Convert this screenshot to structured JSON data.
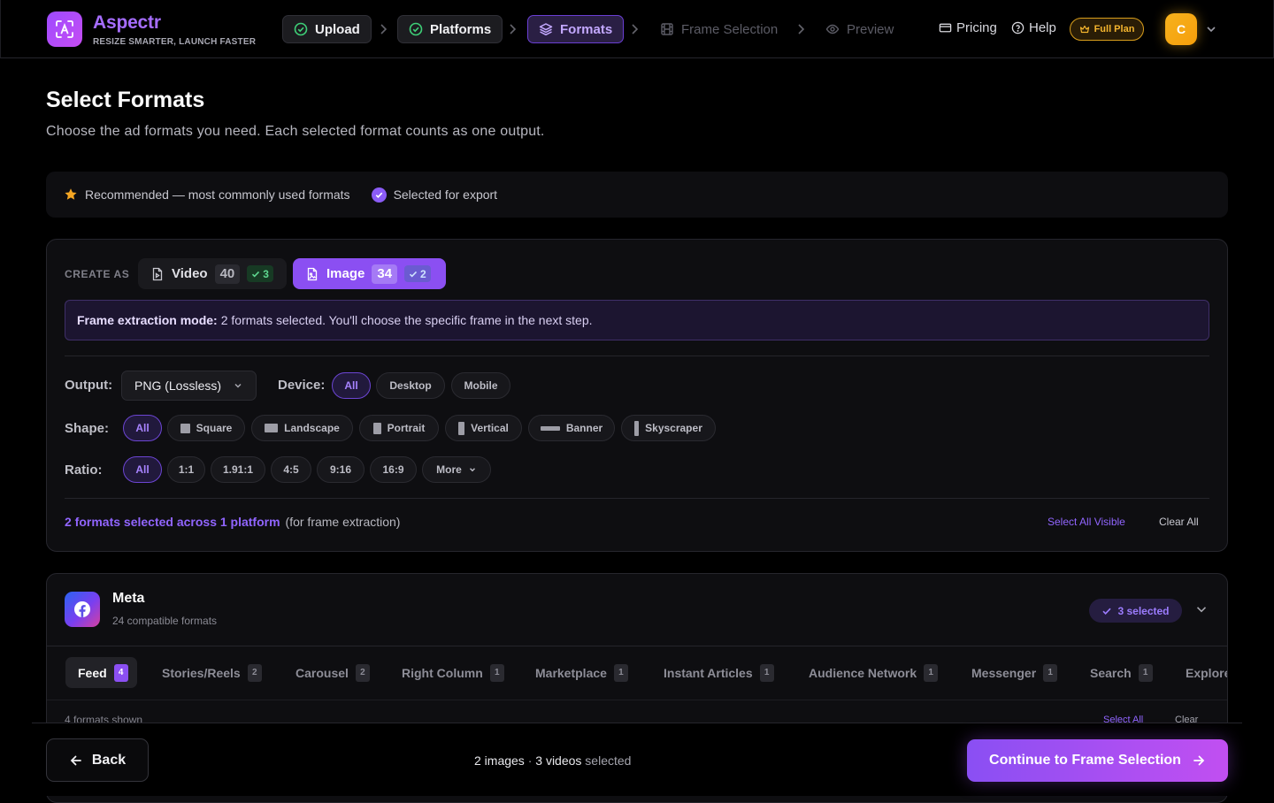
{
  "header": {
    "brand": "Aspectr",
    "tagline": "RESIZE SMARTER, LAUNCH FASTER",
    "steps": [
      {
        "label": "Upload",
        "state": "done"
      },
      {
        "label": "Platforms",
        "state": "done"
      },
      {
        "label": "Formats",
        "state": "active"
      },
      {
        "label": "Frame Selection",
        "state": "todo"
      },
      {
        "label": "Preview",
        "state": "todo"
      }
    ],
    "pricing": "Pricing",
    "help": "Help",
    "plan": "Full Plan",
    "avatar_initial": "C"
  },
  "page": {
    "title": "Select Formats",
    "subtitle": "Choose the ad formats you need. Each selected format counts as one output."
  },
  "legend": {
    "recommended": "Recommended — most commonly used formats",
    "selected": "Selected for export"
  },
  "config": {
    "create_as": "CREATE AS",
    "video": {
      "label": "Video",
      "count": "40",
      "selected": "3"
    },
    "image": {
      "label": "Image",
      "count": "34",
      "selected": "2"
    },
    "info_bold": "Frame extraction mode:",
    "info_text": "2 formats selected. You'll choose the specific frame in the next step.",
    "output_label": "Output:",
    "output_value": "PNG (Lossless)",
    "device_label": "Device:",
    "device_options": [
      "All",
      "Desktop",
      "Mobile"
    ],
    "shape_label": "Shape:",
    "shape_options": [
      "All",
      "Square",
      "Landscape",
      "Portrait",
      "Vertical",
      "Banner",
      "Skyscraper"
    ],
    "ratio_label": "Ratio:",
    "ratio_options": [
      "All",
      "1:1",
      "1.91:1",
      "4:5",
      "9:16",
      "16:9",
      "More"
    ],
    "summary_highlight": "2 formats selected across 1 platform",
    "summary_note": "(for frame extraction)",
    "select_all_visible": "Select All Visible",
    "clear_all": "Clear All",
    "colors": {
      "accent": "#8b4ff2",
      "link": "#9165ff"
    }
  },
  "meta": {
    "name": "Meta",
    "compatible": "24 compatible formats",
    "selected_badge": "3 selected",
    "tabs": [
      {
        "label": "Feed",
        "count": "4"
      },
      {
        "label": "Stories/Reels",
        "count": "2"
      },
      {
        "label": "Carousel",
        "count": "2"
      },
      {
        "label": "Right Column",
        "count": "1"
      },
      {
        "label": "Marketplace",
        "count": "1"
      },
      {
        "label": "Instant Articles",
        "count": "1"
      },
      {
        "label": "Audience Network",
        "count": "1"
      },
      {
        "label": "Messenger",
        "count": "1"
      },
      {
        "label": "Search",
        "count": "1"
      },
      {
        "label": "Explore",
        "count": ""
      }
    ],
    "formats_shown": "4 formats shown",
    "select_all": "Select All",
    "clear": "Clear"
  },
  "footer": {
    "back": "Back",
    "summary_images": "2 images",
    "summary_sep": " · ",
    "summary_videos": "3 videos",
    "summary_tail": " selected",
    "continue": "Continue to Frame Selection"
  }
}
